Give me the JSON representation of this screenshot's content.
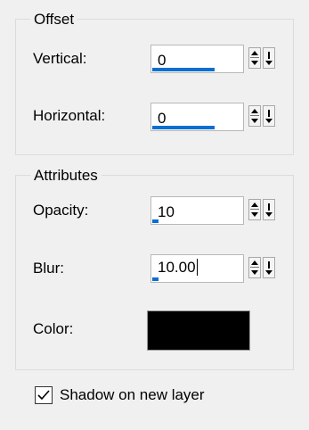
{
  "offset": {
    "title": "Offset",
    "vertical": {
      "label": "Vertical:",
      "value": "0"
    },
    "horizontal": {
      "label": "Horizontal:",
      "value": "0"
    }
  },
  "attributes": {
    "title": "Attributes",
    "opacity": {
      "label": "Opacity:",
      "value": "10"
    },
    "blur": {
      "label": "Blur:",
      "value": "10.00"
    },
    "color": {
      "label": "Color:",
      "value": "#000000"
    }
  },
  "shadow_checkbox": {
    "label": "Shadow on new layer",
    "checked": true
  },
  "colors": {
    "accent": "#0a6fd0"
  }
}
